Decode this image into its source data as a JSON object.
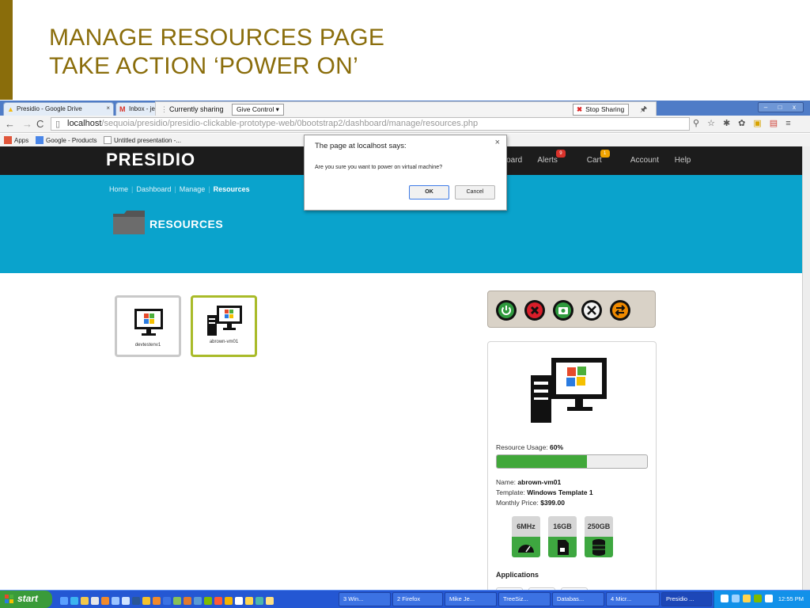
{
  "slide": {
    "title_line1": "MANAGE RESOURCES PAGE",
    "title_line2": "TAKE ACTION ‘POWER ON’"
  },
  "browser": {
    "tabs": [
      {
        "label": "Presidio - Google Drive",
        "close": "×"
      },
      {
        "label": "Inbox - je",
        "close": ""
      }
    ],
    "sharing": {
      "status": "Currently sharing",
      "give_control": "Give Control ▾",
      "stop_sharing": "Stop Sharing"
    },
    "window_controls": {
      "minimize": "–",
      "maximize": "□",
      "close": "x"
    },
    "url_host": "localhost",
    "url_path": "/sequoia/presidio/presidio-clickable-prototype-web/0bootstrap2/dashboard/manage/resources.php",
    "bookmarks": [
      {
        "label": "Apps",
        "color": "#e0563b"
      },
      {
        "label": "Google - Products",
        "color": "#4a86e8"
      },
      {
        "label": "Untitled presentation -...",
        "color": "#ffffff"
      }
    ]
  },
  "site": {
    "brand": "PRESIDIO",
    "nav": {
      "dashboard": "shboard",
      "alerts": "Alerts",
      "alerts_badge": "9",
      "cart": "Cart",
      "cart_badge": "1",
      "account": "Account",
      "help": "Help"
    },
    "breadcrumb": {
      "home": "Home",
      "dashboard": "Dashboard",
      "manage": "Manage",
      "current": "Resources"
    },
    "page_title": "RESOURCES",
    "vms": [
      {
        "name": "devtestenv1",
        "selected": false
      },
      {
        "name": "abrown-vm01",
        "selected": true
      }
    ],
    "actions": [
      {
        "icon": "power-icon",
        "color": "#2f9a3e"
      },
      {
        "icon": "delete-icon",
        "color": "#d81e2a"
      },
      {
        "icon": "snapshot-icon",
        "color": "#2f9a3e"
      },
      {
        "icon": "tools-icon",
        "color": "#ffffff"
      },
      {
        "icon": "migrate-icon",
        "color": "#f08a00"
      }
    ],
    "detail": {
      "usage_label": "Resource Usage:",
      "usage_value": "60%",
      "usage_fraction": 0.6,
      "name_label": "Name:",
      "name_value": "abrown-vm01",
      "template_label": "Template:",
      "template_value": "Windows Template 1",
      "price_label": "Monthly Price:",
      "price_value": "$399.00",
      "specs": [
        {
          "label": "6MHz",
          "icon": "speedometer-icon"
        },
        {
          "label": "16GB",
          "icon": "memory-card-icon"
        },
        {
          "label": "250GB",
          "icon": "database-icon"
        }
      ],
      "applications_title": "Applications"
    },
    "accent": "#0aa3cc"
  },
  "dialog": {
    "title": "The page at localhost says:",
    "close": "×",
    "message": "Are you sure you want to power on virtual machine?",
    "ok": "OK",
    "cancel": "Cancel"
  },
  "taskbar": {
    "start": "start",
    "tasks": [
      {
        "label": "3 Win...",
        "active": false
      },
      {
        "label": "2 Firefox",
        "active": false
      },
      {
        "label": "Mike Je...",
        "active": false
      },
      {
        "label": "TreeSiz...",
        "active": false
      },
      {
        "label": "Databas...",
        "active": false
      },
      {
        "label": "4 Micr...",
        "active": false
      },
      {
        "label": "Presidio ...",
        "active": true
      }
    ],
    "clock": "12:55 PM"
  }
}
